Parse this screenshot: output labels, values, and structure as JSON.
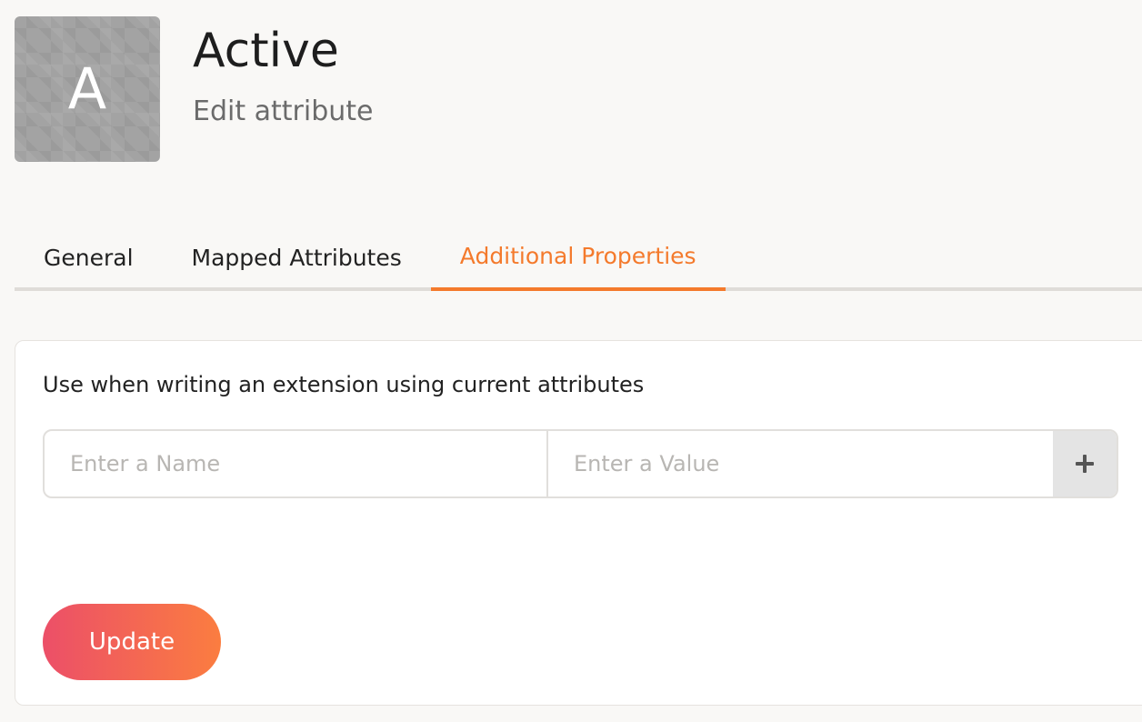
{
  "header": {
    "avatar_letter": "A",
    "title": "Active",
    "subtitle": "Edit attribute"
  },
  "tabs": [
    {
      "label": "General",
      "active": false
    },
    {
      "label": "Mapped Attributes",
      "active": false
    },
    {
      "label": "Additional Properties",
      "active": true
    }
  ],
  "card": {
    "description": "Use when writing an extension using current attributes",
    "name_field": {
      "placeholder": "Enter a Name",
      "value": ""
    },
    "value_field": {
      "placeholder": "Enter a Value",
      "value": ""
    },
    "add_icon": "plus-icon",
    "update_label": "Update"
  },
  "colors": {
    "accent": "#f47a2c",
    "button_gradient_start": "#ec4f68",
    "button_gradient_end": "#fb7d40"
  }
}
